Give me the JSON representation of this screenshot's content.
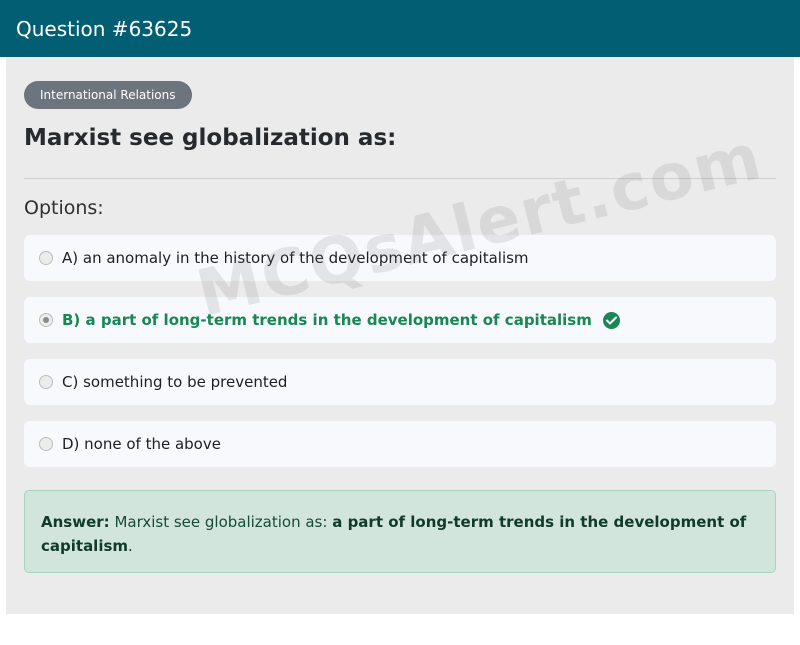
{
  "header": {
    "title": "Question #63625"
  },
  "question": {
    "category": "International Relations",
    "text": "Marxist see globalization as:",
    "options_label": "Options:",
    "options": [
      {
        "label": "A) an anomaly in the history of the development of capitalism",
        "selected": false,
        "correct": false
      },
      {
        "label": "B) a part of long-term trends in the development of capitalism",
        "selected": true,
        "correct": true
      },
      {
        "label": "C) something to be prevented",
        "selected": false,
        "correct": false
      },
      {
        "label": "D) none of the above",
        "selected": false,
        "correct": false
      }
    ]
  },
  "answer": {
    "label": "Answer:",
    "question_text": "Marxist see globalization as:",
    "answer_text": "a part of long-term trends in the development of capitalism",
    "suffix": "."
  },
  "watermark": "MCQsAlert.com",
  "colors": {
    "header_bg": "#025e73",
    "correct": "#198754",
    "answer_bg": "#d2e5dd"
  },
  "icons": {
    "correct_option": "check-circle-icon"
  }
}
